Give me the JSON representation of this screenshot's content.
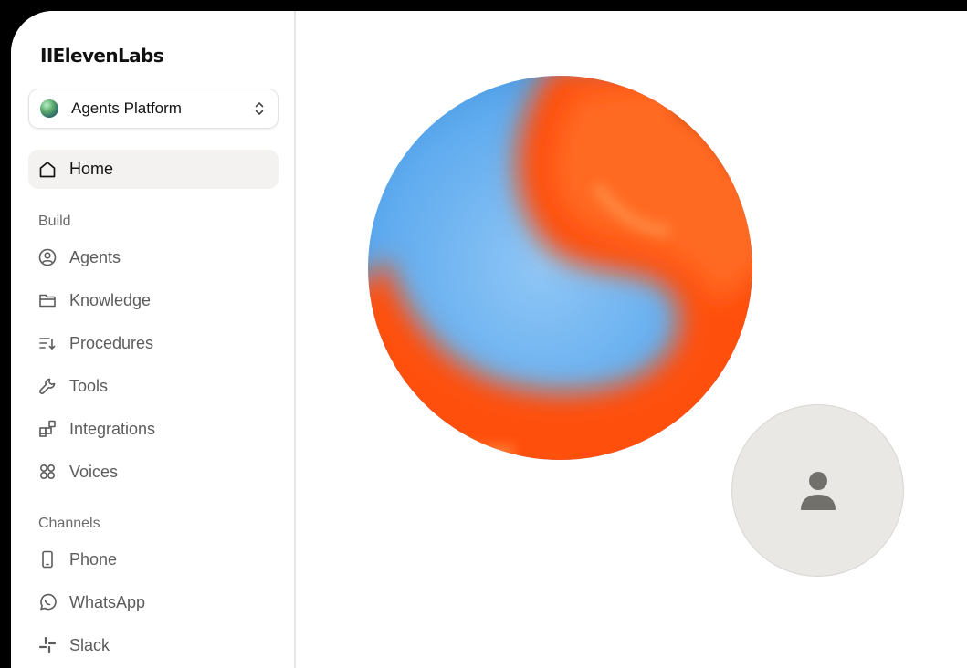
{
  "brand": {
    "logo_text": "IIElevenLabs"
  },
  "workspace": {
    "name": "Agents Platform",
    "chevron_icon": "chevron-up-down-icon"
  },
  "nav": {
    "home": {
      "label": "Home",
      "icon": "home-icon"
    },
    "sections": [
      {
        "title": "Build",
        "items": [
          {
            "label": "Agents",
            "icon": "user-circle-icon"
          },
          {
            "label": "Knowledge",
            "icon": "folder-icon"
          },
          {
            "label": "Procedures",
            "icon": "list-sort-icon"
          },
          {
            "label": "Tools",
            "icon": "wrench-icon"
          },
          {
            "label": "Integrations",
            "icon": "integrations-icon"
          },
          {
            "label": "Voices",
            "icon": "four-circles-icon"
          }
        ]
      },
      {
        "title": "Channels",
        "items": [
          {
            "label": "Phone",
            "icon": "phone-icon"
          },
          {
            "label": "WhatsApp",
            "icon": "whatsapp-icon"
          },
          {
            "label": "Slack",
            "icon": "slack-icon"
          }
        ]
      }
    ]
  },
  "main": {
    "orb": {
      "colors": [
        "#5aa7ee",
        "#ff4f10",
        "#ff7a2a",
        "#8fc6f5"
      ]
    },
    "user_avatar": {
      "icon": "user-icon",
      "color": "#72706a"
    }
  }
}
